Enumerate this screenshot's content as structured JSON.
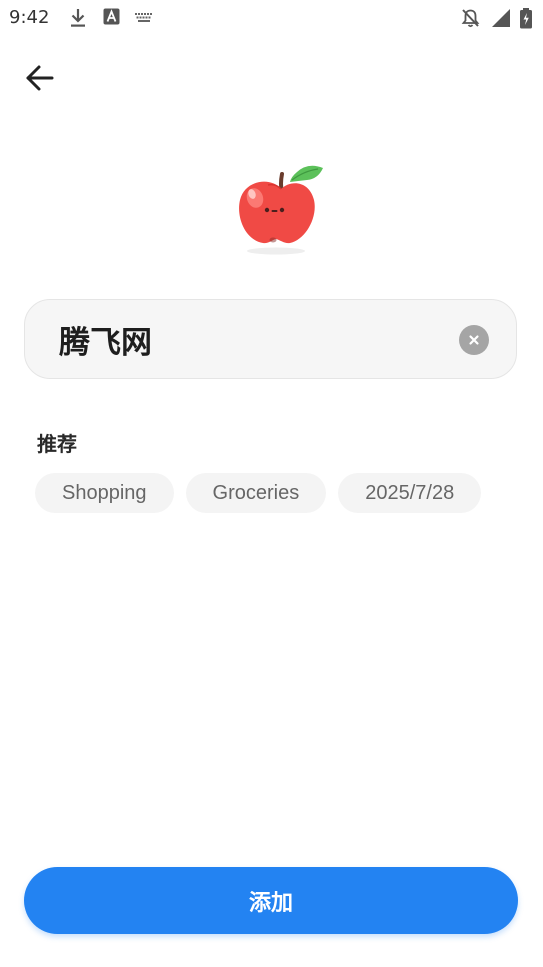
{
  "status_bar": {
    "time": "9:42",
    "icons": [
      "download-icon",
      "text-a-icon",
      "keyboard-icon",
      "notifications-off-icon",
      "signal-icon",
      "battery-charging-icon"
    ]
  },
  "header": {
    "back_icon": "arrow-left-icon"
  },
  "hero": {
    "icon": "apple-icon"
  },
  "name_field": {
    "value": "腾飞网",
    "clear_icon": "close-icon"
  },
  "recommendations": {
    "title": "推荐",
    "chips": [
      "Shopping",
      "Groceries",
      "2025/7/28"
    ]
  },
  "footer": {
    "add_label": "添加"
  },
  "colors": {
    "accent": "#2383f2",
    "field_bg": "#f6f6f6",
    "chip_bg": "#f4f4f4",
    "apple_red": "#f04a45",
    "leaf_green": "#5cc15a"
  }
}
